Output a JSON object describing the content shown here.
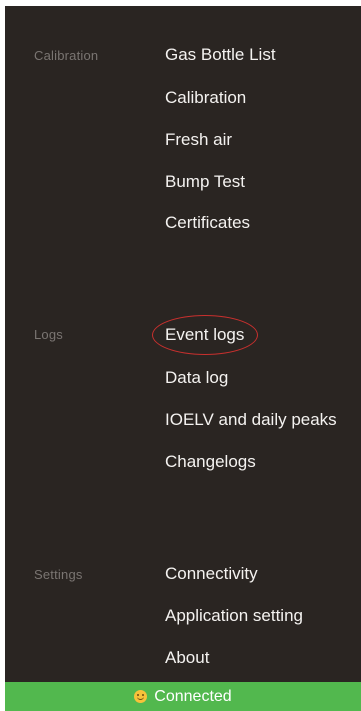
{
  "sections": [
    {
      "label": "Calibration",
      "items": [
        "Gas Bottle List",
        "Calibration",
        "Fresh air",
        "Bump Test",
        "Certificates"
      ]
    },
    {
      "label": "Logs",
      "items": [
        "Event logs",
        "Data log",
        "IOELV and daily peaks",
        "Changelogs"
      ]
    },
    {
      "label": "Settings",
      "items": [
        "Connectivity",
        "Application setting",
        "About"
      ]
    }
  ],
  "status": {
    "icon": "smiley-icon",
    "text": "Connected",
    "color": "#52b84e"
  },
  "highlight": {
    "item": "Event logs",
    "color": "#c8302e"
  }
}
